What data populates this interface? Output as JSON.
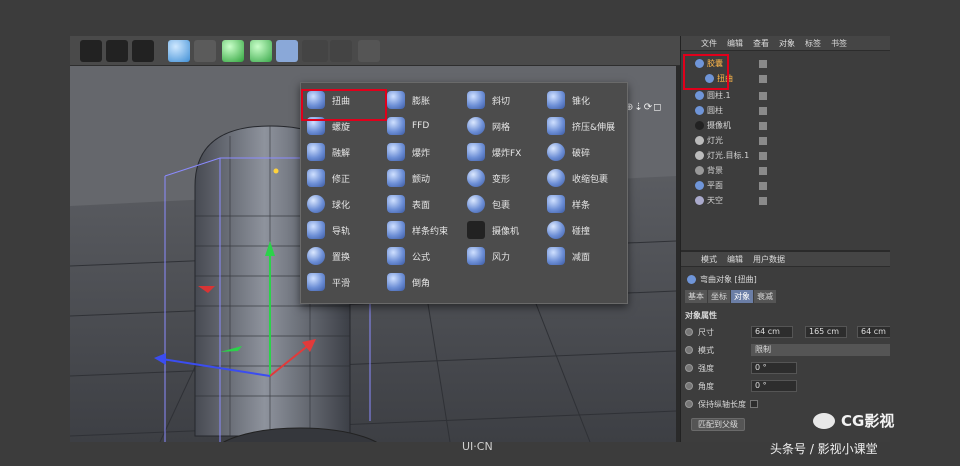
{
  "menu": {
    "col1": [
      "扭曲",
      "螺旋",
      "融解",
      "修正",
      "球化",
      "导轨",
      "置换",
      "平滑"
    ],
    "col2": [
      "膨胀",
      "FFD",
      "爆炸",
      "颤动",
      "表面",
      "样条约束",
      "公式",
      "倒角"
    ],
    "col3": [
      "斜切",
      "网格",
      "爆炸FX",
      "变形",
      "包裹",
      "摄像机",
      "风力"
    ],
    "col4": [
      "锥化",
      "挤压&伸展",
      "破碎",
      "收缩包裹",
      "样条",
      "碰撞",
      "减面"
    ]
  },
  "objects": {
    "menu_bar": [
      "文件",
      "编辑",
      "查看",
      "对象",
      "标签",
      "书签"
    ],
    "items": [
      "胶囊",
      "扭曲",
      "圆柱.1",
      "圆柱",
      "摄像机",
      "灯光",
      "灯光.目标.1",
      "背景",
      "平面",
      "天空"
    ]
  },
  "attributes": {
    "menu_bar": [
      "模式",
      "编辑",
      "用户数据"
    ],
    "title": "弯曲对象 [扭曲]",
    "tabs": [
      "基本",
      "坐标",
      "对象",
      "衰减"
    ],
    "section": "对象属性",
    "size_label": "尺寸",
    "size_values": [
      "64 cm",
      "165 cm",
      "64 cm"
    ],
    "mode_label": "模式",
    "mode_value": "限制",
    "strength_label": "强度",
    "strength_value": "0 °",
    "angle_label": "角度",
    "angle_value": "0 °",
    "keep_length_label": "保持纵轴长度",
    "fit_button": "匹配到父级"
  },
  "watermark": {
    "center": "UI·CN",
    "brand": "CG影视",
    "source": "头条号 / 影视小课堂"
  },
  "colors": {
    "highlight": "#e0001b",
    "tab_active": "#6b7ea6",
    "axis_green": "#2bd24a",
    "axis_red": "#e23a3a",
    "axis_blue": "#3b4df0"
  }
}
